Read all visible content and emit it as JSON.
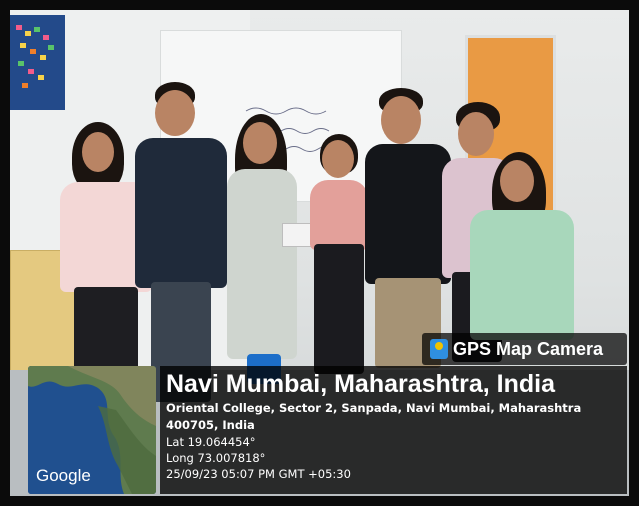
{
  "overlay": {
    "badge": "GPS Map Camera",
    "badge_icon": "map-pin-icon",
    "location_title": "Navi Mumbai, Maharashtra, India",
    "address": "Oriental College, Sector 2, Sanpada, Navi Mumbai, Maharashtra 400705, India",
    "latitude": "Lat 19.064454°",
    "longitude": "Long 73.007818°",
    "datetime": "25/09/23 05:07 PM GMT +05:30"
  },
  "map": {
    "attribution": "Google"
  },
  "colors": {
    "door": "#e99a44",
    "notice_board": "#234a8a",
    "overlay_bg": "#000000"
  }
}
